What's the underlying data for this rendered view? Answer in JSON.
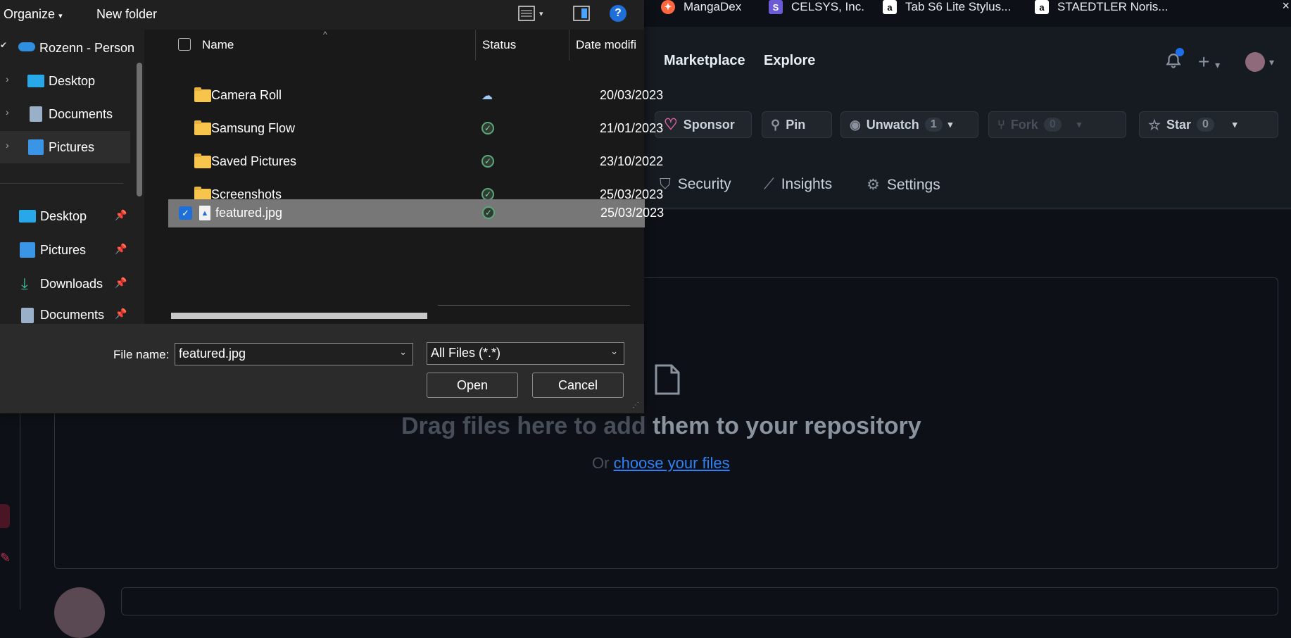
{
  "browser": {
    "bookmarks": [
      {
        "label": "MangaDex",
        "icon": "mangadex-icon"
      },
      {
        "label": "CELSYS, Inc.",
        "icon": "celsys-icon"
      },
      {
        "label": "Tab S6 Lite Stylus...",
        "icon": "amazon-icon"
      },
      {
        "label": "STAEDTLER Noris...",
        "icon": "amazon-icon"
      }
    ]
  },
  "github": {
    "nav": [
      "Marketplace",
      "Explore"
    ],
    "repo_buttons": {
      "sponsor": "Sponsor",
      "pin": "Pin",
      "unwatch": "Unwatch",
      "unwatch_count": "1",
      "fork": "Fork",
      "fork_count": "0",
      "star": "Star",
      "star_count": "0"
    },
    "tabs": [
      "Security",
      "Insights",
      "Settings"
    ],
    "dropzone": {
      "title_part1": "Drag files here to add",
      "title_part2": "them to your repository",
      "or_text": "Or",
      "link_text": "choose your files"
    },
    "colors": {
      "bg": "#0d1117",
      "link": "#2f81f7",
      "border": "#30363d"
    }
  },
  "dialog": {
    "toolbar": {
      "organize": "Organize",
      "new_folder": "New folder"
    },
    "nav": [
      {
        "label": "Rozenn - Person",
        "icon": "onedrive-icon",
        "expandable": false
      },
      {
        "label": "Desktop",
        "icon": "desktop-icon",
        "expandable": true
      },
      {
        "label": "Documents",
        "icon": "documents-icon",
        "expandable": true
      },
      {
        "label": "Pictures",
        "icon": "pictures-icon",
        "expandable": true,
        "selected": true
      }
    ],
    "quick_access": [
      {
        "label": "Desktop",
        "icon": "desktop-icon"
      },
      {
        "label": "Pictures",
        "icon": "pictures-icon"
      },
      {
        "label": "Downloads",
        "icon": "downloads-icon"
      },
      {
        "label": "Documents",
        "icon": "documents-icon"
      }
    ],
    "columns": {
      "name": "Name",
      "status": "Status",
      "date": "Date modifi"
    },
    "files": [
      {
        "name": "Camera Roll",
        "type": "folder",
        "status": "cloud",
        "date": "20/03/2023"
      },
      {
        "name": "Samsung Flow",
        "type": "folder",
        "status": "synced",
        "date": "21/01/2023"
      },
      {
        "name": "Saved Pictures",
        "type": "folder",
        "status": "synced",
        "date": "23/10/2022"
      },
      {
        "name": "Screenshots",
        "type": "folder",
        "status": "synced",
        "date": "25/03/2023"
      },
      {
        "name": "featured.jpg",
        "type": "image",
        "status": "synced",
        "date": "25/03/2023",
        "selected": true
      }
    ],
    "file_name_label": "File name:",
    "file_name_value": "featured.jpg",
    "file_type_value": "All Files (*.*)",
    "open_label": "Open",
    "cancel_label": "Cancel"
  }
}
